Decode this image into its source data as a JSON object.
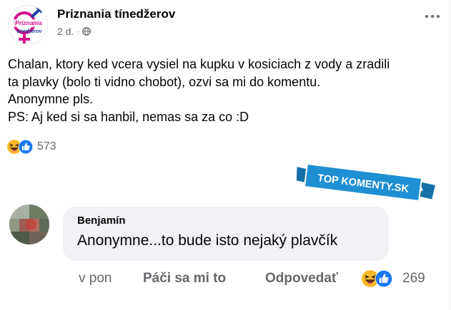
{
  "post": {
    "page_name": "Priznania tínedžerov",
    "time": "2 d.",
    "dot": "·",
    "logo_text_top": "Priznania",
    "logo_text_bottom": "tínedžerov",
    "body_lines": [
      "Chalan, ktory ked vcera vysiel na kupku v kosiciach z vody a zradili",
      "ta plavky (bolo ti vidno chobot), ozvi sa mi do komentu.",
      "Anonymne pls.",
      "PS: Aj ked si sa hanbil, nemas sa za co :D"
    ],
    "reaction_icons": [
      "haha-icon",
      "like-icon"
    ],
    "reaction_count": "573"
  },
  "watermark": {
    "text": "TOP KOMENTY.SK",
    "colors": {
      "ribbon": "#1f8fd4",
      "ribbon_dark": "#156fa8",
      "text": "#ffffff"
    }
  },
  "comment": {
    "author": "Benjamín",
    "text": "Anonymne...to bude isto nejaký plavčík",
    "time": "v pon",
    "like_label": "Páči sa mi to",
    "reply_label": "Odpovedať",
    "reaction_icons": [
      "haha-icon",
      "like-icon"
    ],
    "reaction_count": "269"
  },
  "colors": {
    "text_primary": "#050505",
    "text_secondary": "#65676b",
    "bubble_bg": "#f0f2f5",
    "like_blue": "#1877f2",
    "haha_yellow": "#f7b928",
    "logo_magenta": "#d6138a",
    "logo_blue": "#1b3f9c"
  }
}
